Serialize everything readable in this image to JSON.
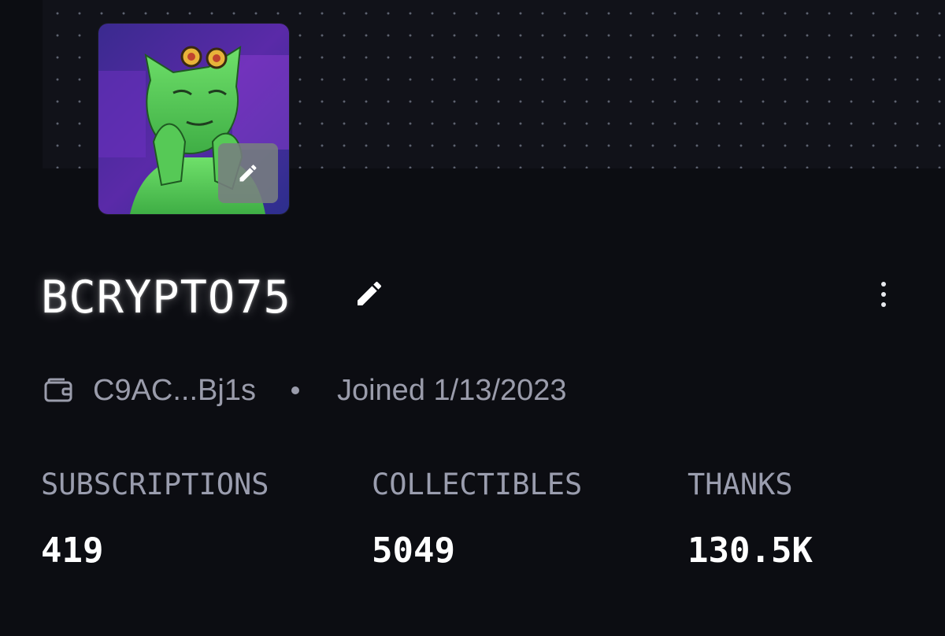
{
  "profile": {
    "username": "BCRYPTO75",
    "wallet_address": "C9AC...Bj1s",
    "joined": "Joined 1/13/2023"
  },
  "stats": [
    {
      "label": "SUBSCRIPTIONS",
      "value": "419"
    },
    {
      "label": "COLLECTIBLES",
      "value": "5049"
    },
    {
      "label": "THANKS",
      "value": "130.5K"
    }
  ],
  "icons": {
    "avatar_edit": "pencil-icon",
    "name_edit": "pencil-icon",
    "menu": "more-vertical-icon",
    "wallet": "wallet-icon"
  },
  "colors": {
    "background": "#0c0d12",
    "banner": "#111219",
    "text_primary": "#ffffff",
    "text_secondary": "#9a9cab",
    "avatar_accent": "#5fd35a"
  }
}
